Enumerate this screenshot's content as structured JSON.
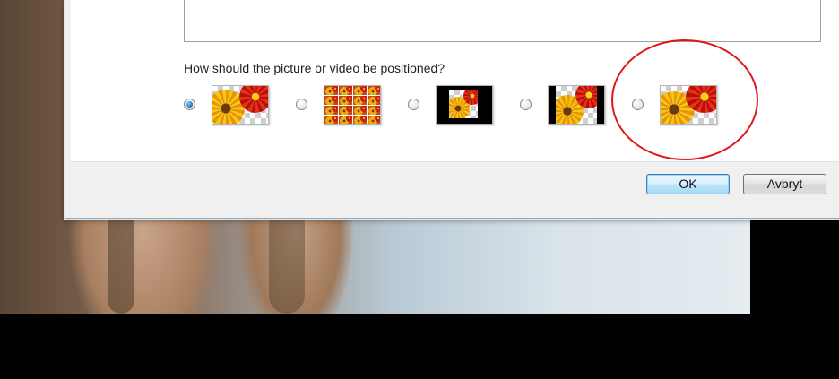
{
  "dialog": {
    "position_question": "How should the picture or video be positioned?",
    "position_options": [
      {
        "id": "fill",
        "selected": true,
        "icon": "fill-preview-icon"
      },
      {
        "id": "tile",
        "selected": false,
        "icon": "tile-preview-icon"
      },
      {
        "id": "center",
        "selected": false,
        "icon": "center-preview-icon"
      },
      {
        "id": "fit",
        "selected": false,
        "icon": "fit-preview-icon"
      },
      {
        "id": "stretch",
        "selected": false,
        "icon": "stretch-preview-icon"
      }
    ],
    "ok_label": "OK",
    "cancel_label": "Avbryt"
  },
  "colors": {
    "annotation": "#e0161a",
    "default_button_border": "#3c7fb1"
  }
}
